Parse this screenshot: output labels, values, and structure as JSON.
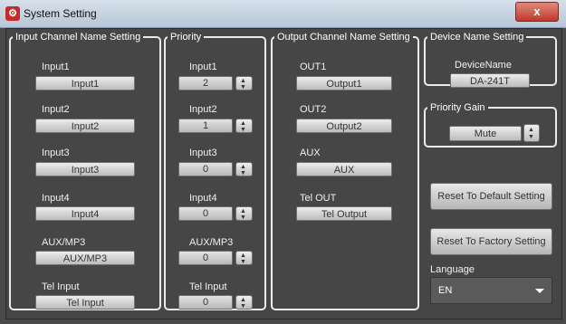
{
  "window": {
    "title": "System Setting",
    "close_label": "x",
    "icon_glyph": "⚙"
  },
  "input_group": {
    "legend": "Input Channel Name Setting",
    "rows": [
      {
        "label": "Input1",
        "value": "Input1"
      },
      {
        "label": "Input2",
        "value": "Input2"
      },
      {
        "label": "Input3",
        "value": "Input3"
      },
      {
        "label": "Input4",
        "value": "Input4"
      },
      {
        "label": "AUX/MP3",
        "value": "AUX/MP3"
      },
      {
        "label": "Tel Input",
        "value": "Tel Input"
      }
    ]
  },
  "priority_group": {
    "legend": "Priority",
    "rows": [
      {
        "label": "Input1",
        "value": "2"
      },
      {
        "label": "Input2",
        "value": "1"
      },
      {
        "label": "Input3",
        "value": "0"
      },
      {
        "label": "Input4",
        "value": "0"
      },
      {
        "label": "AUX/MP3",
        "value": "0"
      },
      {
        "label": "Tel Input",
        "value": "0"
      }
    ]
  },
  "output_group": {
    "legend": "Output Channel Name Setting",
    "rows": [
      {
        "label": "OUT1",
        "value": "Output1"
      },
      {
        "label": "OUT2",
        "value": "Output2"
      },
      {
        "label": "AUX",
        "value": "AUX"
      },
      {
        "label": "Tel OUT",
        "value": "Tel Output"
      }
    ]
  },
  "device_group": {
    "legend": "Device Name Setting",
    "label": "DeviceName",
    "value": "DA-241T"
  },
  "priority_gain_group": {
    "legend": "Priority Gain",
    "value": "Mute"
  },
  "actions": {
    "reset_default": "Reset To Default Setting",
    "reset_factory": "Reset To Factory Setting"
  },
  "language": {
    "label": "Language",
    "value": "EN"
  }
}
